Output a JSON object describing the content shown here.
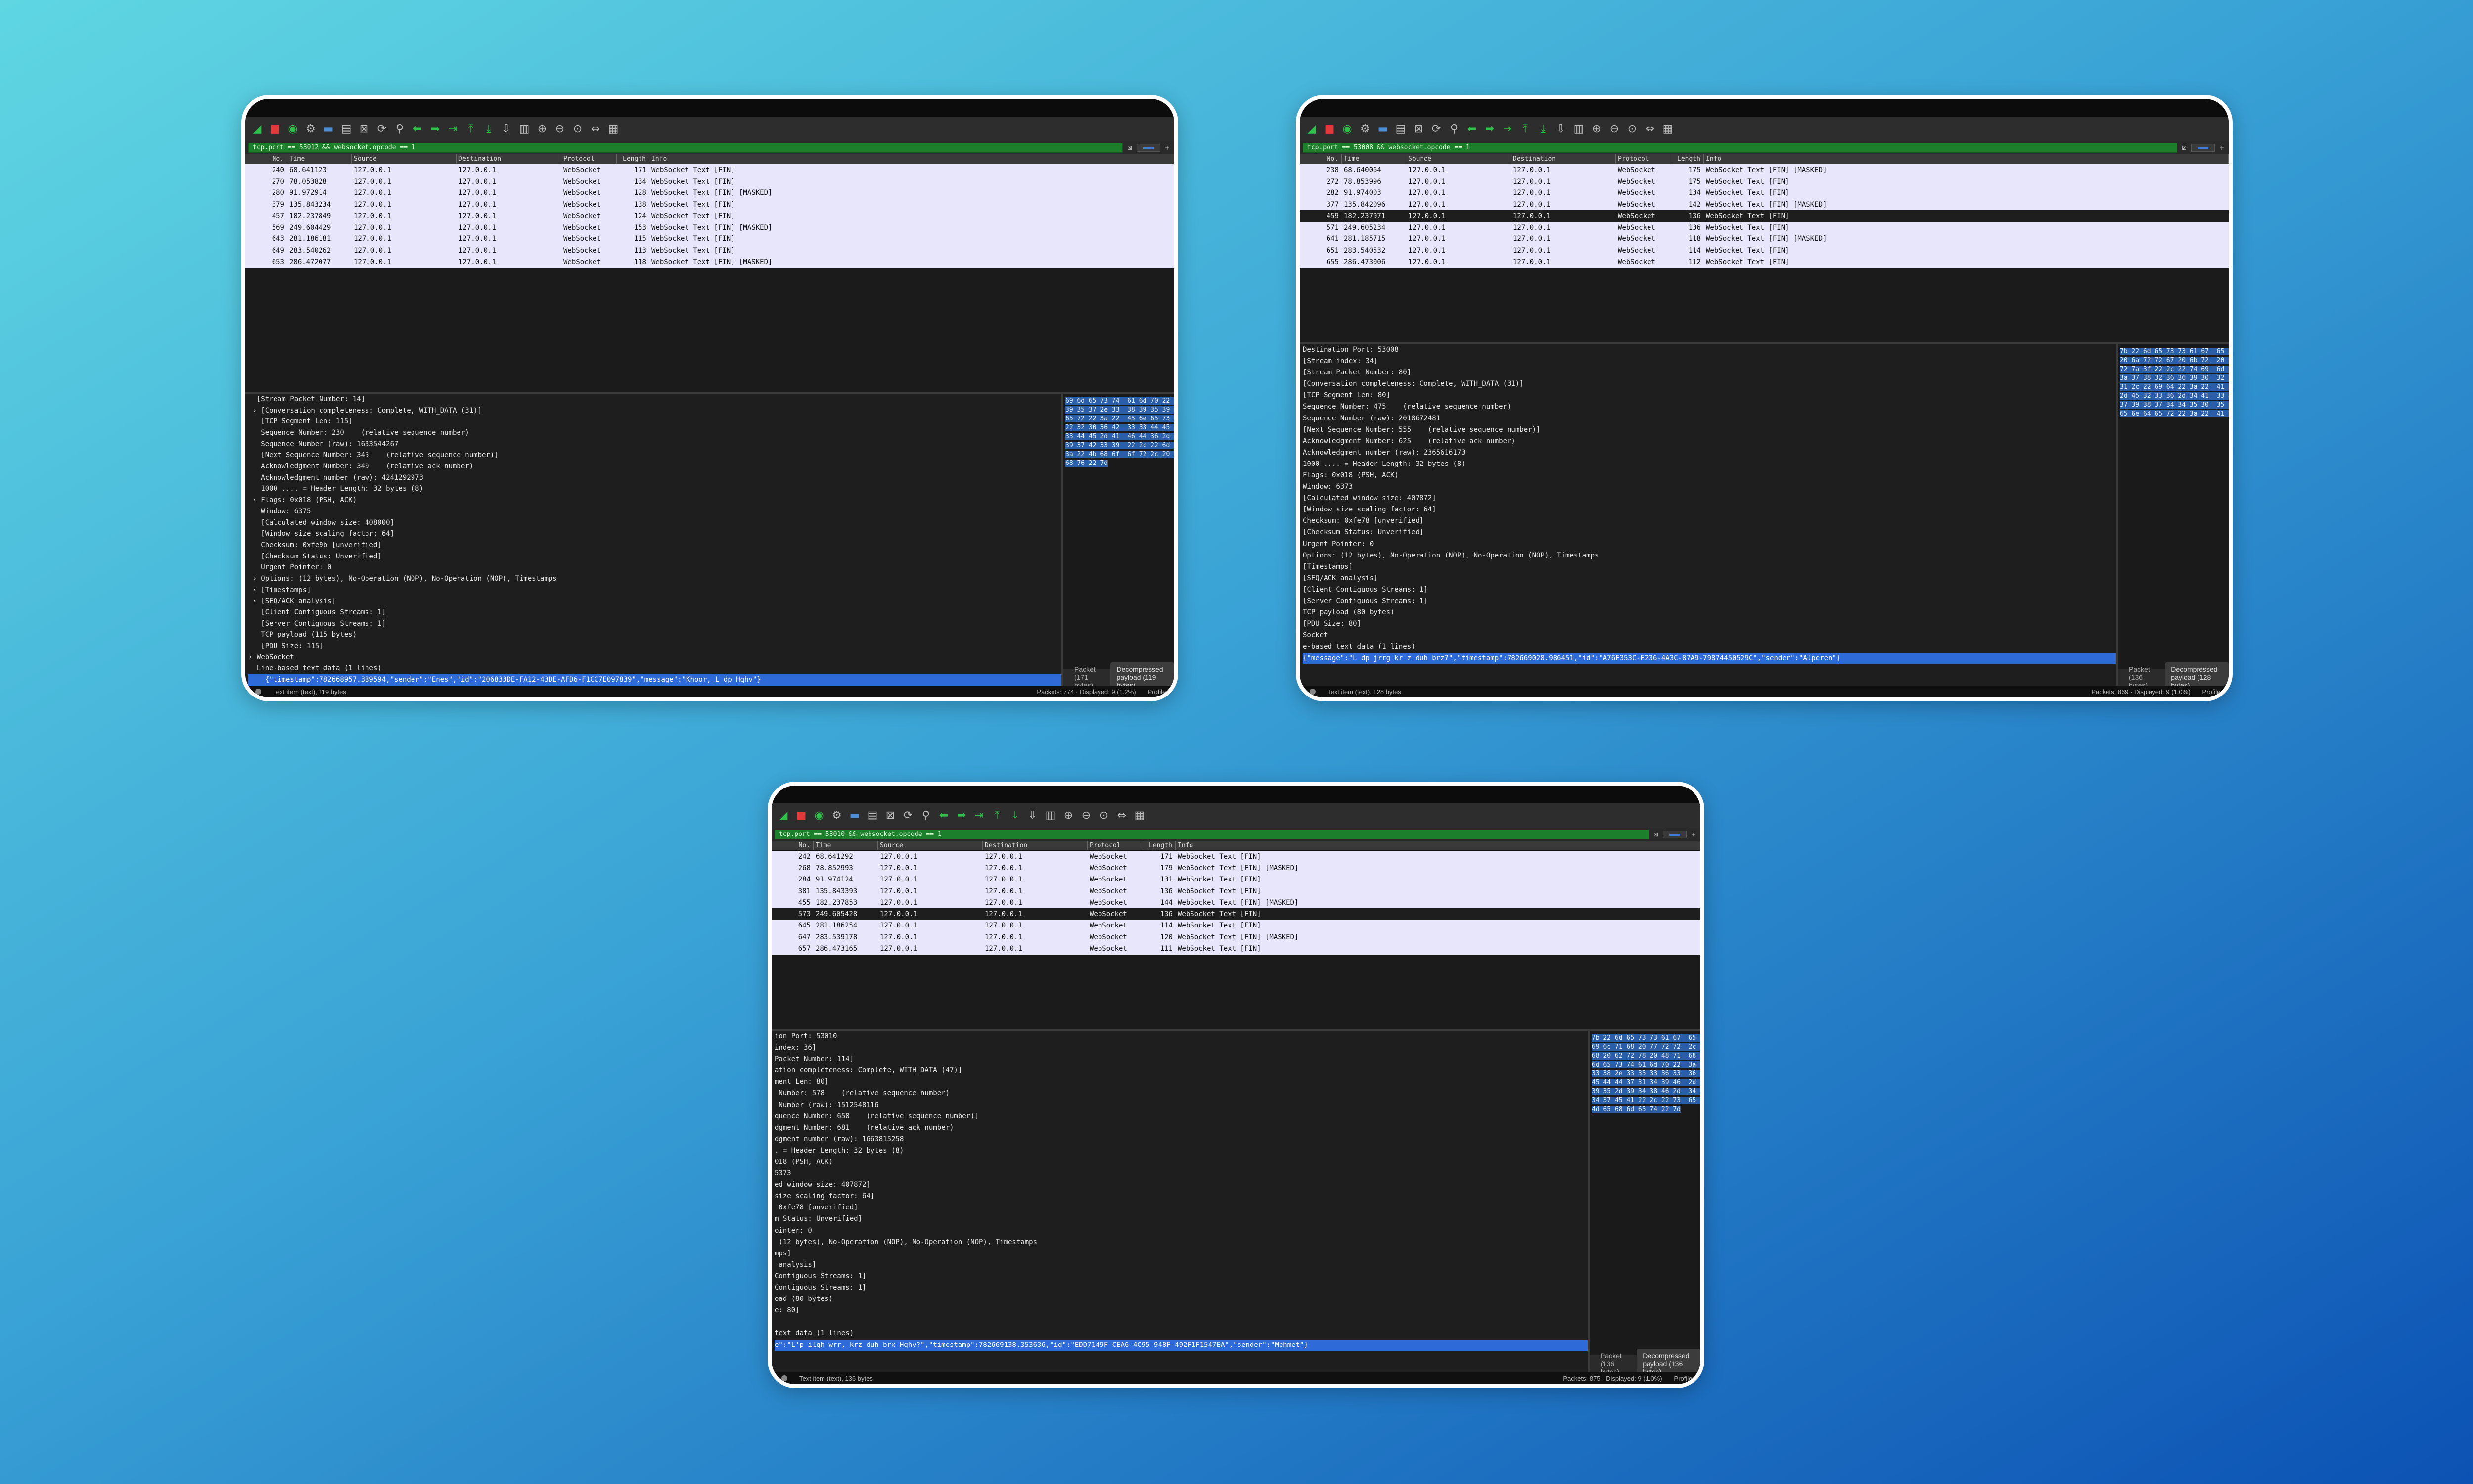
{
  "windows": [
    {
      "id": "w1",
      "filter": "tcp.port == 53012 && websocket.opcode == 1",
      "columns": [
        "No.",
        "Time",
        "Source",
        "Destination",
        "Protocol",
        "Length",
        "Info"
      ],
      "rows": [
        [
          "240",
          "68.641123",
          "127.0.0.1",
          "127.0.0.1",
          "WebSocket",
          "171",
          "WebSocket Text [FIN]"
        ],
        [
          "270",
          "78.053828",
          "127.0.0.1",
          "127.0.0.1",
          "WebSocket",
          "134",
          "WebSocket Text [FIN]"
        ],
        [
          "280",
          "91.972914",
          "127.0.0.1",
          "127.0.0.1",
          "WebSocket",
          "128",
          "WebSocket Text [FIN] [MASKED]"
        ],
        [
          "379",
          "135.843234",
          "127.0.0.1",
          "127.0.0.1",
          "WebSocket",
          "138",
          "WebSocket Text [FIN]"
        ],
        [
          "457",
          "182.237849",
          "127.0.0.1",
          "127.0.0.1",
          "WebSocket",
          "124",
          "WebSocket Text [FIN]"
        ],
        [
          "569",
          "249.604429",
          "127.0.0.1",
          "127.0.0.1",
          "WebSocket",
          "153",
          "WebSocket Text [FIN] [MASKED]"
        ],
        [
          "643",
          "281.186181",
          "127.0.0.1",
          "127.0.0.1",
          "WebSocket",
          "115",
          "WebSocket Text [FIN]"
        ],
        [
          "649",
          "283.540262",
          "127.0.0.1",
          "127.0.0.1",
          "WebSocket",
          "113",
          "WebSocket Text [FIN]"
        ],
        [
          "653",
          "286.472077",
          "127.0.0.1",
          "127.0.0.1",
          "WebSocket",
          "118",
          "WebSocket Text [FIN] [MASKED]"
        ]
      ],
      "details": [
        "  [Stream Packet Number: 14]",
        " › [Conversation completeness: Complete, WITH_DATA (31)]",
        "   [TCP Segment Len: 115]",
        "   Sequence Number: 230    (relative sequence number)",
        "   Sequence Number (raw): 1633544267",
        "   [Next Sequence Number: 345    (relative sequence number)]",
        "   Acknowledgment Number: 340    (relative ack number)",
        "   Acknowledgment number (raw): 4241292973",
        "   1000 .... = Header Length: 32 bytes (8)",
        " › Flags: 0x018 (PSH, ACK)",
        "   Window: 6375",
        "   [Calculated window size: 408000]",
        "   [Window size scaling factor: 64]",
        "   Checksum: 0xfe9b [unverified]",
        "   [Checksum Status: Unverified]",
        "   Urgent Pointer: 0",
        " › Options: (12 bytes), No-Operation (NOP), No-Operation (NOP), Timestamps",
        " › [Timestamps]",
        " › [SEQ/ACK analysis]",
        "   [Client Contiguous Streams: 1]",
        "   [Server Contiguous Streams: 1]",
        "   TCP payload (115 bytes)",
        "   [PDU Size: 115]",
        "› WebSocket",
        "  Line-based text data (1 lines)",
        "    {\"timestamp\":782668957.389594,\"sender\":\"Enes\",\"id\":\"206833DE-FA12-43DE-AFD6-F1CC7E097839\",\"message\":\"Khoor, L dp Hqhv\"}"
      ],
      "hex": [
        "69 6d 65 73 74  61 6d 70 22 3a 37 38 32",
        "39 35 37 2e 33  38 39 35 39 34 2c 22 73",
        "65 72 22 3a 22  45 6e 65 73 22 2c 22 69",
        "22 32 30 36 42  33 33 44 45 2d 46 41 31",
        "33 44 45 2d 41  46 44 36 2d 46 31 43 43",
        "39 37 42 33 39  22 2c 22 6d 65 73 73 61",
        "3a 22 4b 68 6f  6f 72 2c 20 4c 20 64 70",
        "68 76 22 7d"
      ],
      "ascii": [
        "{\"timest amp\":782",
        "668957.3 89594,\"s",
        "ender\":\" Enes\",\"i",
        "d\":\"2068 33DE-FA1",
        "2-43DE-A FD6-F1CC",
        "7E097839 \",\"messa",
        "ge\":\"Kho or, L dp",
        " Hqhv\"}"
      ],
      "tab_packet": "Packet (171 bytes)",
      "tab_payload": "Decompressed payload (119 bytes)",
      "status_left": "Text item (text), 119 bytes",
      "status_mid": "Packets: 774 · Displayed: 9 (1.2%)",
      "status_right": "Profile: D"
    },
    {
      "id": "w2",
      "filter": "tcp.port == 53008 && websocket.opcode == 1",
      "columns": [
        "No.",
        "Time",
        "Source",
        "Destination",
        "Protocol",
        "Length",
        "Info"
      ],
      "rows": [
        [
          "238",
          "68.640064",
          "127.0.0.1",
          "127.0.0.1",
          "WebSocket",
          "175",
          "WebSocket Text [FIN] [MASKED]"
        ],
        [
          "272",
          "78.853996",
          "127.0.0.1",
          "127.0.0.1",
          "WebSocket",
          "175",
          "WebSocket Text [FIN]"
        ],
        [
          "282",
          "91.974003",
          "127.0.0.1",
          "127.0.0.1",
          "WebSocket",
          "134",
          "WebSocket Text [FIN]"
        ],
        [
          "377",
          "135.842096",
          "127.0.0.1",
          "127.0.0.1",
          "WebSocket",
          "142",
          "WebSocket Text [FIN] [MASKED]"
        ],
        [
          "459",
          "182.237971",
          "127.0.0.1",
          "127.0.0.1",
          "WebSocket",
          "136",
          "WebSocket Text [FIN]"
        ],
        [
          "571",
          "249.605234",
          "127.0.0.1",
          "127.0.0.1",
          "WebSocket",
          "136",
          "WebSocket Text [FIN]"
        ],
        [
          "641",
          "281.185715",
          "127.0.0.1",
          "127.0.0.1",
          "WebSocket",
          "118",
          "WebSocket Text [FIN] [MASKED]"
        ],
        [
          "651",
          "283.540532",
          "127.0.0.1",
          "127.0.0.1",
          "WebSocket",
          "114",
          "WebSocket Text [FIN]"
        ],
        [
          "655",
          "286.473006",
          "127.0.0.1",
          "127.0.0.1",
          "WebSocket",
          "112",
          "WebSocket Text [FIN]"
        ]
      ],
      "selected": 4,
      "details": [
        "Destination Port: 53008",
        "[Stream index: 34]",
        "[Stream Packet Number: 80]",
        "[Conversation completeness: Complete, WITH_DATA (31)]",
        "[TCP Segment Len: 80]",
        "Sequence Number: 475    (relative sequence number)",
        "Sequence Number (raw): 2018672481",
        "[Next Sequence Number: 555    (relative sequence number)]",
        "Acknowledgment Number: 625    (relative ack number)",
        "Acknowledgment number (raw): 2365616173",
        "1000 .... = Header Length: 32 bytes (8)",
        "Flags: 0x018 (PSH, ACK)",
        "Window: 6373",
        "[Calculated window size: 407872]",
        "[Window size scaling factor: 64]",
        "Checksum: 0xfe78 [unverified]",
        "[Checksum Status: Unverified]",
        "Urgent Pointer: 0",
        "Options: (12 bytes), No-Operation (NOP), No-Operation (NOP), Timestamps",
        "[Timestamps]",
        "[SEQ/ACK analysis]",
        "[Client Contiguous Streams: 1]",
        "[Server Contiguous Streams: 1]",
        "TCP payload (80 bytes)",
        "[PDU Size: 80]",
        "Socket",
        "e-based text data (1 lines)",
        "{\"message\":\"L dp jrrg kr z duh brz?\",\"timestamp\":782669028.986451,\"id\":\"A76F353C-E236-4A3C-87A9-79874450529C\",\"sender\":\"Alperen\"}"
      ],
      "hex": [
        "7b 22 6d 65 73 73 61 67  65 22 3a 22 4c 20 64 70",
        "20 6a 72 72 67 20 6b 72  20 7a 20 64 75 68 20 62",
        "72 7a 3f 22 2c 22 74 69  6d 65 73 74 61 6d 70 22",
        "3a 37 38 32 36 36 39 30  32 38 2e 39 38 36 34 35",
        "31 2c 22 69 64 22 3a 22  41 37 36 46 33 35 33 43",
        "2d 45 32 33 36 2d 34 41  33 43 2d 38 37 41 39 2d",
        "37 39 38 37 34 34 35 30  35 32 39 43 22 2c 22 73",
        "65 6e 64 65 72 22 3a 22  41 6c 70 65 72 65 6e 22 7d"
      ],
      "ascii": [
        "{\"messag e\":\"L dp",
        " jrrg kr z duh br",
        "z?\",\"tim estamp\"",
        ":7826690 28.98645",
        "1,\"id\":\" A76F353C",
        "-E236-4A 3C-87A9-",
        "79874450 529C\",\"s",
        "ender\":\"A lperen\"}"
      ],
      "tab_packet": "Packet (136 bytes)",
      "tab_payload": "Decompressed payload (128 bytes)",
      "status_left": "Text item (text), 128 bytes",
      "status_mid": "Packets: 869 · Displayed: 9 (1.0%)",
      "status_right": "Profile: D"
    },
    {
      "id": "w3",
      "filter": "tcp.port == 53010 && websocket.opcode == 1",
      "columns": [
        "No.",
        "Time",
        "Source",
        "Destination",
        "Protocol",
        "Length",
        "Info"
      ],
      "rows": [
        [
          "242",
          "68.641292",
          "127.0.0.1",
          "127.0.0.1",
          "WebSocket",
          "171",
          "WebSocket Text [FIN]"
        ],
        [
          "268",
          "78.852993",
          "127.0.0.1",
          "127.0.0.1",
          "WebSocket",
          "179",
          "WebSocket Text [FIN] [MASKED]"
        ],
        [
          "284",
          "91.974124",
          "127.0.0.1",
          "127.0.0.1",
          "WebSocket",
          "131",
          "WebSocket Text [FIN]"
        ],
        [
          "381",
          "135.843393",
          "127.0.0.1",
          "127.0.0.1",
          "WebSocket",
          "136",
          "WebSocket Text [FIN]"
        ],
        [
          "455",
          "182.237853",
          "127.0.0.1",
          "127.0.0.1",
          "WebSocket",
          "144",
          "WebSocket Text [FIN] [MASKED]"
        ],
        [
          "573",
          "249.605428",
          "127.0.0.1",
          "127.0.0.1",
          "WebSocket",
          "136",
          "WebSocket Text [FIN]"
        ],
        [
          "645",
          "281.186254",
          "127.0.0.1",
          "127.0.0.1",
          "WebSocket",
          "114",
          "WebSocket Text [FIN]"
        ],
        [
          "647",
          "283.539178",
          "127.0.0.1",
          "127.0.0.1",
          "WebSocket",
          "120",
          "WebSocket Text [FIN] [MASKED]"
        ],
        [
          "657",
          "286.473165",
          "127.0.0.1",
          "127.0.0.1",
          "WebSocket",
          "111",
          "WebSocket Text [FIN]"
        ]
      ],
      "selected": 5,
      "details": [
        "ion Port: 53010",
        "index: 36]",
        "Packet Number: 114]",
        "ation completeness: Complete, WITH_DATA (47)]",
        "ment Len: 80]",
        " Number: 578    (relative sequence number)",
        " Number (raw): 1512548116",
        "quence Number: 658    (relative sequence number)]",
        "dgment Number: 681    (relative ack number)",
        "dgment number (raw): 1663815258",
        ". = Header Length: 32 bytes (8)",
        "018 (PSH, ACK)",
        "5373",
        "ed window size: 407872]",
        "size scaling factor: 64]",
        " 0xfe78 [unverified]",
        "m Status: Unverified]",
        "ointer: 0",
        " (12 bytes), No-Operation (NOP), No-Operation (NOP), Timestamps",
        "mps]",
        " analysis]",
        "Contiguous Streams: 1]",
        "Contiguous Streams: 1]",
        "oad (80 bytes)",
        "e: 80]",
        "",
        "text data (1 lines)",
        "e\":\"L'p ilqh wrr, krz duh brx Hqhv?\",\"timestamp\":782669138.353636,\"id\":\"EDD7149F-CEA6-4C95-948F-492F1F1547EA\",\"sender\":\"Mehmet\"}"
      ],
      "hex": [
        "7b 22 6d 65 73 73 61 67  65 22 3a 22 4c 27 70 20",
        "69 6c 71 68 20 77 72 72  2c 20 6b 72 7a 20 64 75",
        "68 20 62 72 78 20 48 71  68 76 3f 22 2c 22 74 69",
        "6d 65 73 74 61 6d 70 22  3a 37 38 32 36 36 39 31",
        "33 38 2e 33 35 33 36 33  36 2c 22 69 64 22 3a 22",
        "45 44 44 37 31 34 39 46  2d 43 45 41 36 2d 34 43",
        "39 35 2d 39 34 38 46 2d  34 39 32 46 31 46 31 35",
        "34 37 45 41 22 2c 22 73  65 6e 64 65 72 22 3a 22",
        "4d 65 68 6d 65 74 22 7d"
      ],
      "ascii": [
        "{\"messag e\":\"L'p",
        " ilqh wrr , krz du",
        "h brx Hq hv?\",\"ti",
        "mestamp\": 7826691",
        "38.35363 6,\"id\":\"",
        "EDD7149F -CEA6-4C",
        "95-948F- 492F1F15",
        "47EA\",\"s ender\":\"",
        "Mehmet\"}"
      ],
      "tab_packet": "Packet (136 bytes)",
      "tab_payload": "Decompressed payload (136 bytes)",
      "status_left": "Text item (text), 136 bytes",
      "status_mid": "Packets: 875 · Displayed: 9 (1.0%)",
      "status_right": "Profile: D"
    }
  ],
  "toolbar_icons": [
    "shark-fin-icon",
    "stop-capture-icon",
    "restart-capture-icon",
    "capture-options-icon",
    "open-file-icon",
    "save-file-icon",
    "close-file-icon",
    "reload-file-icon",
    "find-packet-icon",
    "go-back-icon",
    "go-forward-icon",
    "go-to-packet-icon",
    "go-first-icon",
    "go-last-icon",
    "auto-scroll-icon",
    "colorize-icon",
    "zoom-in-icon",
    "zoom-out-icon",
    "zoom-reset-icon",
    "resize-columns-icon",
    "layout-icon"
  ],
  "colors": {
    "filter_bg": "#1b7f2b",
    "list_bg": "#e8e6fa",
    "selection": "#2f6bd8"
  }
}
